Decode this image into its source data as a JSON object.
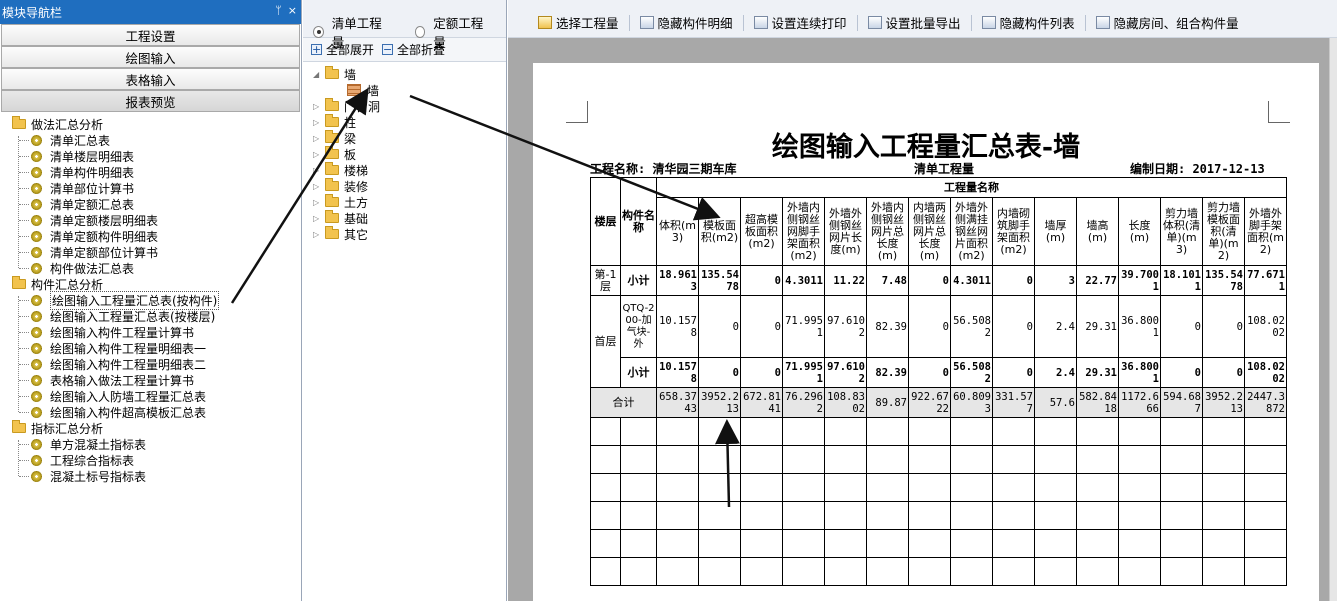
{
  "nav": {
    "title": "模块导航栏",
    "pin": "ᛘ",
    "close": "×",
    "buttons": [
      "工程设置",
      "绘图输入",
      "表格输入",
      "报表预览"
    ],
    "groups": [
      {
        "label": "做法汇总分析",
        "items": [
          "清单汇总表",
          "清单楼层明细表",
          "清单构件明细表",
          "清单部位计算书",
          "清单定额汇总表",
          "清单定额楼层明细表",
          "清单定额构件明细表",
          "清单定额部位计算书",
          "构件做法汇总表"
        ]
      },
      {
        "label": "构件汇总分析",
        "items": [
          "绘图输入工程量汇总表(按构件)",
          "绘图输入工程量汇总表(按楼层)",
          "绘图输入构件工程量计算书",
          "绘图输入构件工程量明细表一",
          "绘图输入构件工程量明细表二",
          "表格输入做法工程量计算书",
          "绘图输入人防墙工程量汇总表",
          "绘图输入构件超高模板汇总表"
        ]
      },
      {
        "label": "指标汇总分析",
        "items": [
          "单方混凝土指标表",
          "工程综合指标表",
          "混凝土标号指标表"
        ]
      }
    ]
  },
  "mid": {
    "radio_qd": "清单工程量",
    "radio_de": "定额工程量",
    "expand_all": "全部展开",
    "collapse_all": "全部折叠",
    "tree_root": "墙",
    "tree_child": "墙",
    "tree_items": [
      "门窗洞",
      "柱",
      "梁",
      "板",
      "楼梯",
      "装修",
      "土方",
      "基础",
      "其它"
    ]
  },
  "toolbar": {
    "items": [
      "选择工程量",
      "隐藏构件明细",
      "设置连续打印",
      "设置批量导出",
      "隐藏构件列表",
      "隐藏房间、组合构件量"
    ]
  },
  "report": {
    "title": "绘图输入工程量汇总表-墙",
    "project": "工程名称: 清华园三期车库",
    "type": "清单工程量",
    "date": "编制日期: 2017-12-13",
    "group_header": "工程量名称",
    "col_floor": "楼层",
    "col_name": "构件名称",
    "columns": [
      "体积(m3)",
      "模板面积(m2)",
      "超高模板面积(m2)",
      "外墙内侧钢丝网脚手架面积(m2)",
      "外墙外侧钢丝网片长度(m)",
      "外墙内侧钢丝网片总长度(m)",
      "内墙两侧钢丝网片总长度(m)",
      "外墙外侧满挂钢丝网片面积(m2)",
      "内墙砌筑脚手架面积(m2)",
      "墙厚(m)",
      "墙高(m)",
      "长度(m)",
      "剪力墙体积(清单)(m3)",
      "剪力墙模板面积(清单)(m2)",
      "外墙外脚手架面积(m2)"
    ],
    "rows": [
      {
        "floor": "第-1层",
        "name": "小计",
        "bold": true,
        "values": [
          "18.9613",
          "135.5478",
          "0",
          "4.3011",
          "11.22",
          "7.48",
          "0",
          "4.3011",
          "0",
          "3",
          "22.77",
          "39.7001",
          "18.1011",
          "135.5478",
          "77.6711"
        ]
      },
      {
        "floor": "首层",
        "name": "QTQ-200-加气块-外",
        "bold": false,
        "values": [
          "10.1578",
          "0",
          "0",
          "71.9951",
          "97.6102",
          "82.39",
          "0",
          "56.5082",
          "0",
          "2.4",
          "29.31",
          "36.8001",
          "0",
          "0",
          "108.0202"
        ]
      },
      {
        "floor": "",
        "name": "小计",
        "bold": true,
        "values": [
          "10.1578",
          "0",
          "0",
          "71.9951",
          "97.6102",
          "82.39",
          "0",
          "56.5082",
          "0",
          "2.4",
          "29.31",
          "36.8001",
          "0",
          "0",
          "108.0202"
        ]
      }
    ],
    "total_label": "合计",
    "total_values": [
      "658.3743",
      "3952.213",
      "672.8141",
      "76.2962",
      "108.8302",
      "89.87",
      "922.6722",
      "60.8093",
      "331.577",
      "57.6",
      "582.8418",
      "1172.666",
      "594.687",
      "3952.213",
      "2447.3872"
    ]
  }
}
